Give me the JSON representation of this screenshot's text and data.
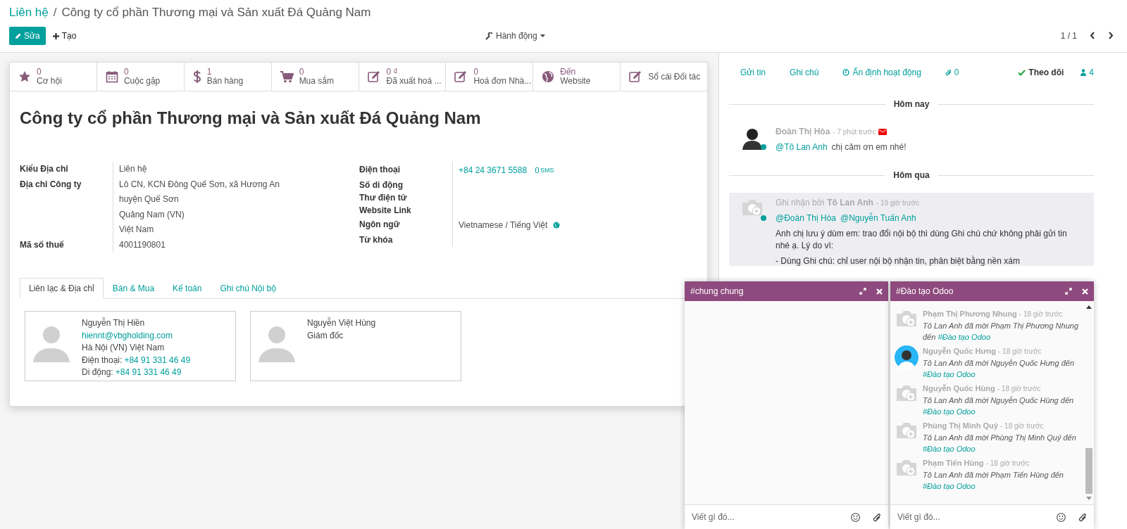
{
  "breadcrumb": {
    "parent": "Liên hệ",
    "separator": "/",
    "current": "Công ty cổ phần Thương mại và Sản xuất Đá Quảng Nam"
  },
  "toolbar": {
    "edit": "Sửa",
    "create": "Tạo",
    "action": "Hành động",
    "pager": "1 / 1"
  },
  "stat_buttons": [
    {
      "kind": "star",
      "value": "0",
      "label": "Cơ hội"
    },
    {
      "kind": "calendar",
      "value": "0",
      "label": "Cuộc gặp"
    },
    {
      "kind": "dollar",
      "value": "1",
      "label": "Bán hàng"
    },
    {
      "kind": "cart",
      "value": "0",
      "label": "Mua sắm"
    },
    {
      "kind": "pencil",
      "value": "0 ₫",
      "label": "Đã xuất hoá ..."
    },
    {
      "kind": "pencil",
      "value": "0",
      "label": "Hoá đơn Nhà..."
    },
    {
      "kind": "globe",
      "value": "Đến",
      "label": "Website"
    },
    {
      "kind": "pencil",
      "label": "Sổ cái Đối tác"
    }
  ],
  "record_title": "Công ty cổ phần Thương mại và Sản xuất Đá Quảng Nam",
  "fields_left": [
    {
      "label": "Kiểu Địa chỉ",
      "values": [
        "Liên hệ"
      ]
    },
    {
      "label": "Địa chỉ Công ty",
      "values": [
        "Lô CN, KCN Đông Quế Sơn, xã Hương An",
        "huyện Quế Sơn",
        "Quảng Nam (VN)",
        "Việt Nam"
      ]
    },
    {
      "label": "Mã số thuế",
      "values": [
        "4001190801"
      ]
    }
  ],
  "fields_right": [
    {
      "label": "Điện thoại",
      "kind": "phone",
      "value": "+84 24 3671 5588",
      "action": "SMS"
    },
    {
      "label": "Số di động",
      "kind": "empty"
    },
    {
      "label": "Thư điện tử",
      "kind": "empty"
    },
    {
      "label": "Website Link",
      "kind": "empty"
    },
    {
      "label": "Ngôn ngữ",
      "kind": "language",
      "value": "Vietnamese / Tiếng Việt"
    },
    {
      "label": "Từ khóa",
      "kind": "empty"
    }
  ],
  "tabs": [
    {
      "label": "Liên lạc & Địa chỉ",
      "selected": true
    },
    {
      "label": "Bán & Mua",
      "selected": false
    },
    {
      "label": "Kế toán",
      "selected": false
    },
    {
      "label": "Ghi chú Nội bộ",
      "selected": false
    }
  ],
  "contacts": [
    {
      "name": "Nguyễn Thị Hiền",
      "email": "hiennt@vbgholding.com",
      "address": "Hà Nội (VN) Việt Nam",
      "phone_label": "Điện thoại:",
      "phone": "+84 91 331 46 49",
      "mobile_label": "Di động:",
      "mobile": "+84 91 331 46 49"
    },
    {
      "name": "Nguyễn Việt Hùng",
      "job": "Giám đốc"
    }
  ],
  "chatter": {
    "send": "Gửi tin",
    "note": "Ghi chú",
    "schedule": "Ấn định hoạt động",
    "attachments": "0",
    "follow": "Theo dõi",
    "followers": "4",
    "days": [
      {
        "label": "Hôm nay",
        "messages": [
          {
            "kind": "message",
            "photo": true,
            "author": "Đoàn Thị Hòa",
            "time": "- 7 phút trước",
            "mentions": [
              "@Tô Lan Anh"
            ],
            "lines": [
              "chị cảm ơn em nhé!"
            ]
          }
        ]
      },
      {
        "label": "Hôm qua",
        "messages": [
          {
            "kind": "note",
            "photo": false,
            "prefix": "Ghi nhận bởi",
            "author": "Tô Lan Anh",
            "time": "- 19 giờ trước",
            "mentions": [
              "@Đoàn Thị Hòa",
              "@Nguyễn Tuấn Anh"
            ],
            "lines": [
              "Anh chị lưu ý dùm em:  trao đổi nội bộ thì dùng Ghi chú chứ không phải gửi tin nhé ạ. Lý do vì:",
              "- Dùng Ghi chú:  chỉ user nội bộ nhận tin, phân biệt bằng nền xám"
            ]
          }
        ]
      }
    ]
  },
  "chat_windows": [
    {
      "title": "#chung chung",
      "placeholder": "Viết gì đó..."
    },
    {
      "title": "#Đào tạo Odoo",
      "placeholder": "Viết gì đó...",
      "messages": [
        {
          "photo": false,
          "author": "Phạm Thị Phương Nhung",
          "time": "- 18 giờ trước",
          "text": "Tô Lan Anh đã mời Phạm Thị Phương Nhung đến",
          "channel": "#Đào tạo Odoo"
        },
        {
          "photo": true,
          "author": "Nguyễn Quốc Hưng",
          "time": "- 18 giờ trước",
          "text": "Tô Lan Anh đã mời Nguyễn Quốc Hưng đến",
          "channel": "#Đào tạo Odoo"
        },
        {
          "photo": false,
          "author": "Nguyễn Quốc Hùng",
          "time": "- 18 giờ trước",
          "text": "Tô Lan Anh đã mời Nguyễn Quốc Hùng đến",
          "channel": "#Đào tạo Odoo"
        },
        {
          "photo": false,
          "author": "Phùng Thị Minh Quý",
          "time": "- 18 giờ trước",
          "text": "Tô Lan Anh đã mời Phùng Thị Minh Quý đến",
          "channel": "#Đào tạo Odoo"
        },
        {
          "photo": false,
          "author": "Phạm Tiến Hùng",
          "time": "- 18 giờ trước",
          "text": "Tô Lan Anh đã mời Phạm Tiến Hùng đến",
          "channel": "#Đào tạo Odoo"
        }
      ]
    }
  ]
}
